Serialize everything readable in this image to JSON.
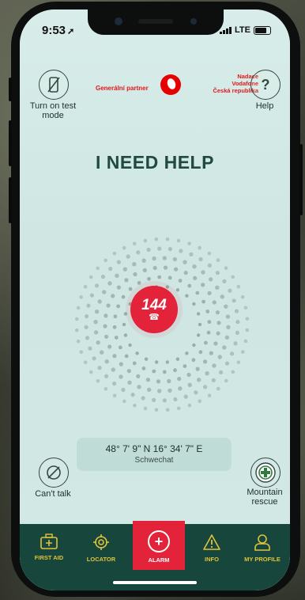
{
  "status": {
    "time": "9:53",
    "network": "LTE"
  },
  "top": {
    "test_mode_label": "Turn on test mode",
    "help_icon_text": "?",
    "help_label": "Help",
    "partner_label": "Generální partner",
    "partner_org": [
      "Nadace",
      "Vodafone",
      "Česká republika"
    ]
  },
  "main": {
    "title": "I NEED HELP",
    "alarm_number": "144",
    "alarm_phone_icon": "☎"
  },
  "location": {
    "coordinates": "48° 7' 9\" N 16° 34' 7\" E",
    "place": "Schwechat"
  },
  "side": {
    "cant_talk_label": "Can't talk",
    "mountain_rescue_label": "Mountain rescue"
  },
  "tabs": [
    {
      "label": "FIRST AID",
      "icon": "first-aid-kit-icon"
    },
    {
      "label": "LOCATOR",
      "icon": "crosshair-icon"
    },
    {
      "label": "ALARM",
      "icon": "plus-circle-icon"
    },
    {
      "label": "INFO",
      "icon": "warning-triangle-icon"
    },
    {
      "label": "MY PROFILE",
      "icon": "person-icon"
    }
  ],
  "colors": {
    "accent": "#e2233a",
    "tabbar": "#17463c",
    "tab_text": "#e1c33b",
    "title": "#1f4a3d"
  }
}
